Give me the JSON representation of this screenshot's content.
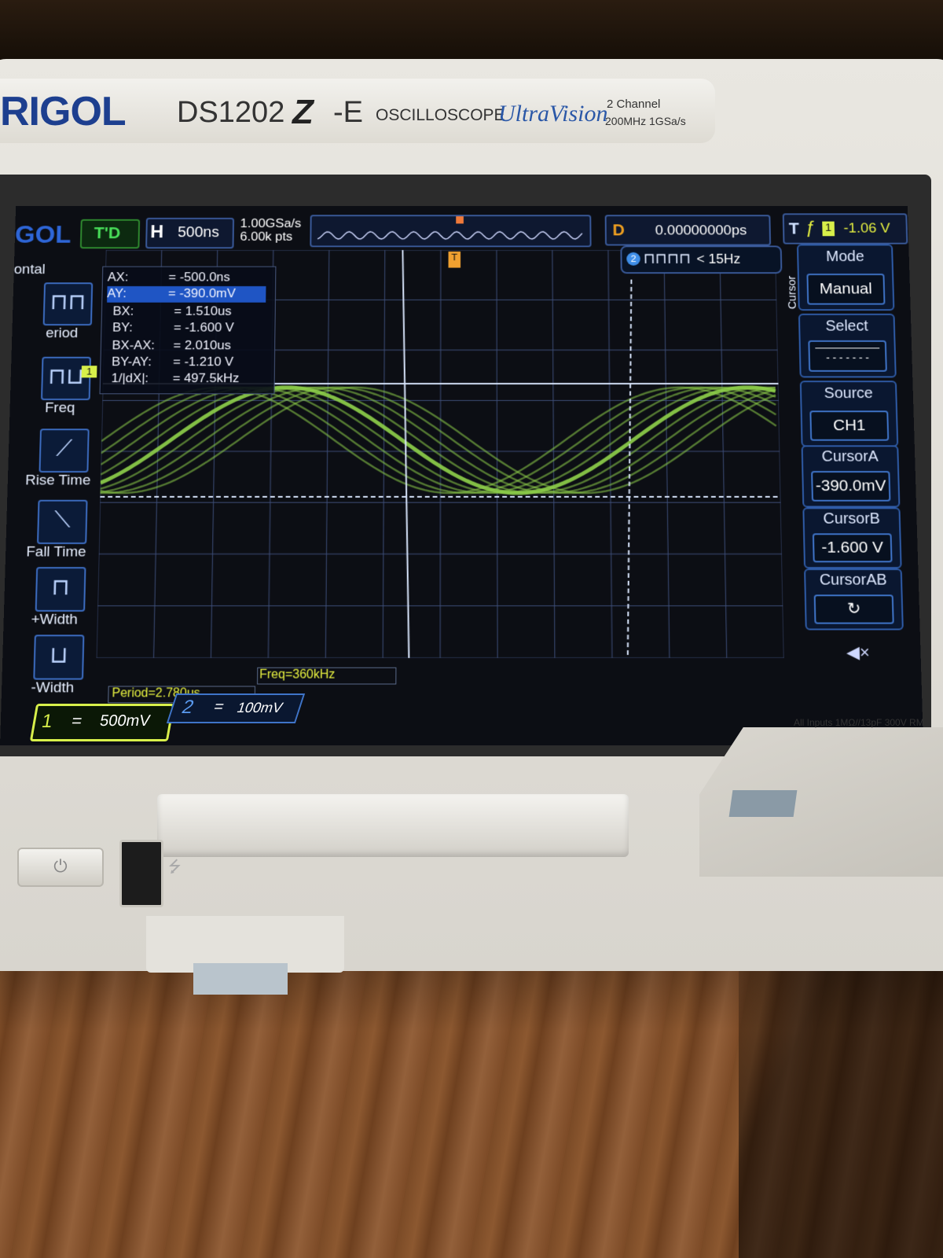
{
  "device": {
    "brand": "RIGOL",
    "model": "DS1202",
    "model_z": "Z",
    "model_suffix": "-E",
    "type": "OSCILLOSCOPE",
    "series": "UltraVision",
    "spec_line1": "2 Channel",
    "spec_line2": "200MHz  1GSa/s",
    "input_note": "All Inputs 1MΩ//13pF 300V RM"
  },
  "status_bar": {
    "logo": "GOL",
    "trigger_status": "T'D",
    "horizontal_label": "H",
    "timebase": "500ns",
    "sample_rate": "1.00GSa/s",
    "memory_depth": "6.00k pts",
    "delay_label": "D",
    "delay": "0.00000000ps",
    "trigger_label": "T",
    "trigger_channel": "1",
    "trigger_level": "-1.06 V"
  },
  "left_menu": {
    "header": "ontal",
    "items": [
      {
        "name": "period",
        "label": "eriod"
      },
      {
        "name": "freq",
        "label": "Freq"
      },
      {
        "name": "rise-time",
        "label": "Rise Time"
      },
      {
        "name": "fall-time",
        "label": "Fall Time"
      },
      {
        "name": "plus-width",
        "label": "+Width"
      },
      {
        "name": "minus-width",
        "label": "-Width"
      }
    ]
  },
  "cursor_readout": {
    "rows": [
      {
        "key": "AX:",
        "value": "=  -500.0ns"
      },
      {
        "key": "AY:",
        "value": "=  -390.0mV"
      },
      {
        "key": "BX:",
        "value": "=  1.510us"
      },
      {
        "key": "BY:",
        "value": "=  -1.600 V"
      },
      {
        "key": "BX-AX:",
        "value": "=  2.010us"
      },
      {
        "key": "BY-AY:",
        "value": "=  -1.210 V"
      },
      {
        "key": "1/|dX|:",
        "value": "=  497.5kHz"
      }
    ],
    "selected_index": 1
  },
  "ch2_frequency": {
    "channel": "2",
    "text": "< 15Hz"
  },
  "right_menu": {
    "side_label": "Cursor",
    "mode": {
      "title": "Mode",
      "value": "Manual"
    },
    "select": {
      "title": "Select"
    },
    "source": {
      "title": "Source",
      "value": "CH1"
    },
    "cursor_a": {
      "title": "CursorA",
      "value": "-390.0mV"
    },
    "cursor_b": {
      "title": "CursorB",
      "value": "-1.600 V"
    },
    "cursor_ab": {
      "title": "CursorAB"
    }
  },
  "measurements": {
    "period": "Period=2.780us",
    "freq": "Freq=360kHz"
  },
  "channels": {
    "ch1": {
      "number": "1",
      "coupling": "=",
      "scale": "500mV",
      "color": "#d8f04a"
    },
    "ch2": {
      "number": "2",
      "coupling": "=",
      "scale": "100mV",
      "color": "#3f74c8"
    }
  },
  "colors": {
    "trace": "#8fd24a",
    "grid": "#3e4f7a",
    "cursor": "#dbe8ff",
    "accent": "#2f5ca8"
  },
  "icons": {
    "power": "power-icon",
    "usb": "usb-icon",
    "mute": "mute-icon",
    "trigger_edge": "falling-edge-icon"
  }
}
